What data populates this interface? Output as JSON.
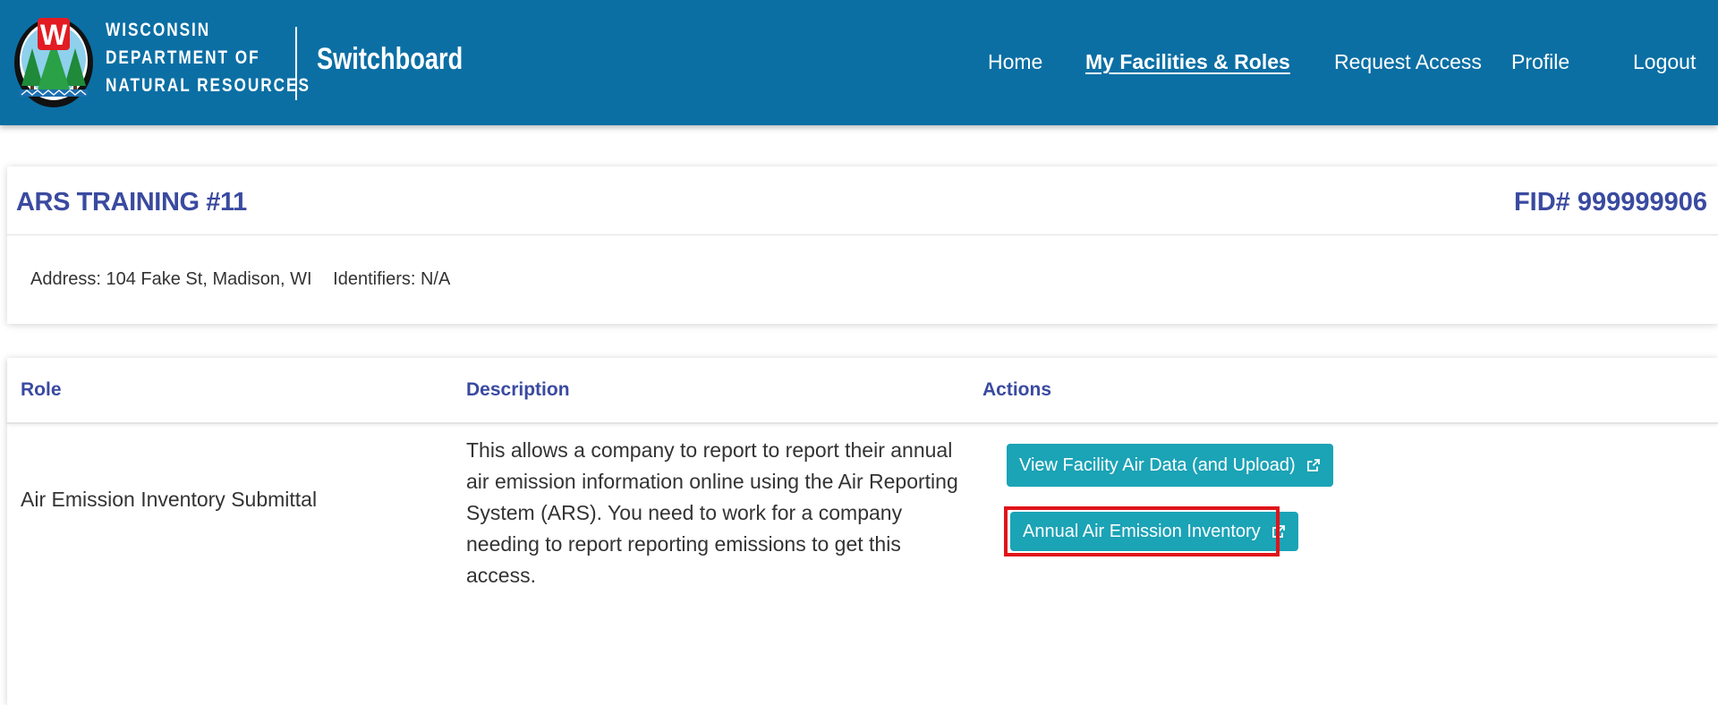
{
  "header": {
    "agency_line1": "WISCONSIN",
    "agency_line2": "DEPARTMENT OF",
    "agency_line3": "NATURAL RESOURCES",
    "app_title": "Switchboard",
    "logo_letter": "W",
    "nav": [
      {
        "label": "Home",
        "active": false
      },
      {
        "label": "My Facilities & Roles",
        "active": true
      },
      {
        "label": "Request Access",
        "active": false
      },
      {
        "label": "Profile",
        "active": false
      },
      {
        "label": "Logout",
        "active": false
      }
    ]
  },
  "facility": {
    "name": "ARS TRAINING #11",
    "fid": "FID# 999999906",
    "address": "Address: 104 Fake St, Madison, WI",
    "identifiers": "Identifiers: N/A"
  },
  "roles_table": {
    "headers": {
      "role": "Role",
      "description": "Description",
      "actions": "Actions"
    },
    "rows": [
      {
        "role": "Air Emission Inventory Submittal",
        "description": "This allows a company to report to report their annual air emission information online using the Air Reporting System (ARS). You need to work for a company needing to report reporting emissions to get this access.",
        "actions": [
          {
            "label": "View Facility Air Data (and Upload)",
            "icon": "external-link-icon"
          },
          {
            "label": "Annual Air Emission Inventory",
            "icon": "external-link-icon",
            "highlighted": true
          }
        ]
      }
    ]
  },
  "colors": {
    "header_bg": "#0b6fa4",
    "heading_text": "#3a4aa0",
    "button_bg": "#1ba3b6",
    "highlight_border": "#e0141a"
  }
}
